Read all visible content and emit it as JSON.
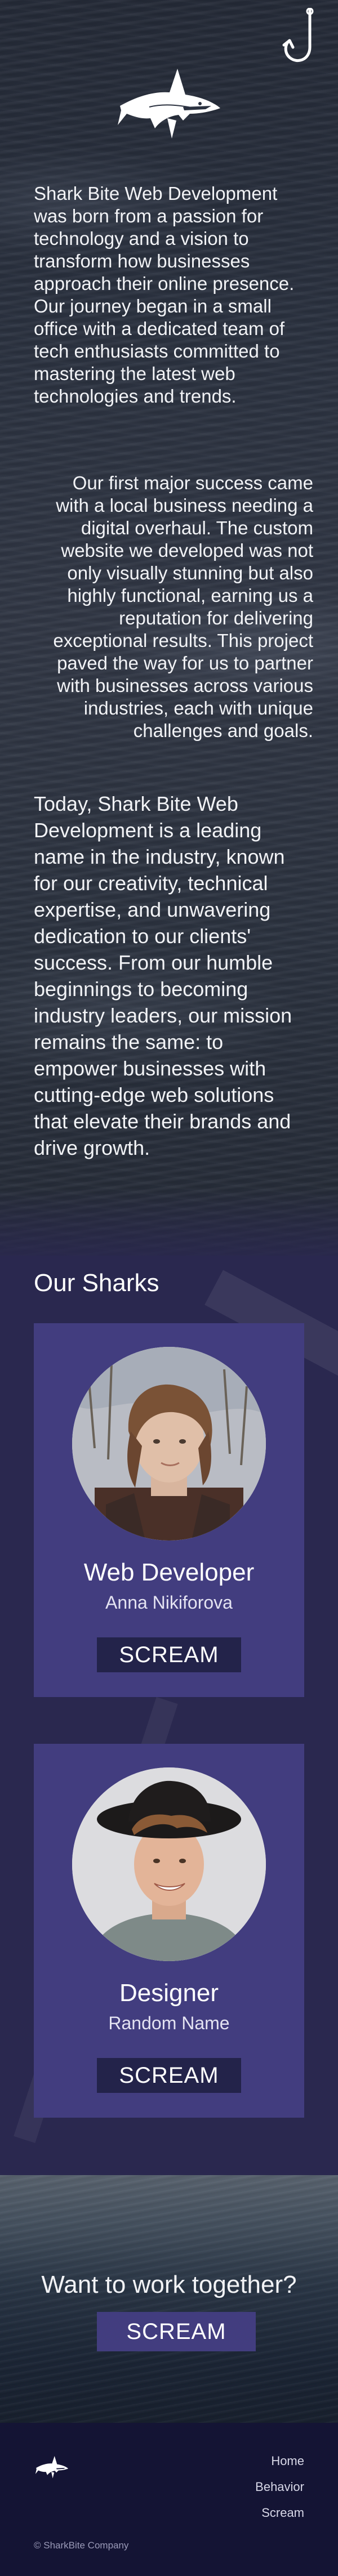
{
  "hero": {
    "paragraph_1": "Shark Bite Web Development was born from a passion for technology and a vision to transform how businesses approach their online presence. Our journey began in a small office with a dedicated team of tech enthusiasts committed to mastering the latest web technologies and trends.",
    "paragraph_2": "Our first major success came with a local business needing a digital overhaul. The custom website we developed was not only visually stunning but also highly functional, earning us a reputation for delivering exceptional results. This project paved the way for us to partner with businesses across various industries, each with unique challenges and goals.",
    "paragraph_3": "Today, Shark Bite Web Development is a leading name in the industry, known for our creativity, technical expertise, and unwavering dedication to our clients' success. From our humble beginnings to becoming industry leaders, our mission remains the same: to empower businesses with cutting-edge web solutions that elevate their brands and drive growth."
  },
  "team": {
    "title": "Our Sharks",
    "members": [
      {
        "role": "Web Developer",
        "name": "Anna Nikiforova",
        "button": "SCREAM"
      },
      {
        "role": "Designer",
        "name": "Random Name",
        "button": "SCREAM"
      }
    ]
  },
  "cta": {
    "title": "Want to work together?",
    "button": "SCREAM"
  },
  "footer": {
    "nav": [
      "Home",
      "Behavior",
      "Scream"
    ],
    "copyright": "© SharkBite Company"
  },
  "colors": {
    "team_background": "#2a284f",
    "card": "#423d7f",
    "button_dark": "#23234a",
    "footer": "#141434"
  },
  "icons": [
    "fish-hook-icon",
    "shark-logo-icon"
  ]
}
